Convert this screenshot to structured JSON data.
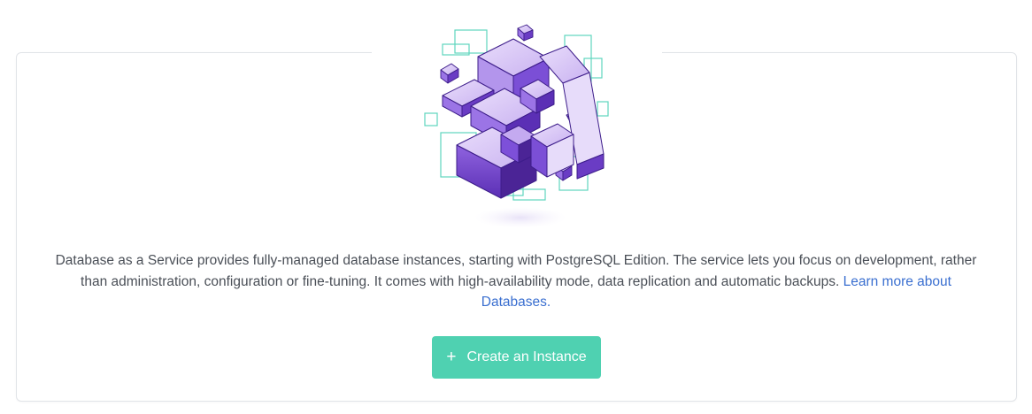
{
  "empty_state": {
    "description": "Database as a Service provides fully-managed database instances, starting with PostgreSQL Edition. The service lets you focus on development, rather than administration, configuration or fine-tuning. It comes with high-availability mode, data replication and automatic backups.",
    "learn_more_link": "Learn more about Databases.",
    "illustration_icon": "database-cubes-illustration"
  },
  "actions": {
    "create_button_label": "Create an Instance",
    "create_button_icon": "plus-icon"
  },
  "colors": {
    "accent": "#4fd1b1",
    "link": "#3a6fd0",
    "illustration_purple": "#7b4fd6",
    "illustration_outline": "#5fd6bd"
  }
}
